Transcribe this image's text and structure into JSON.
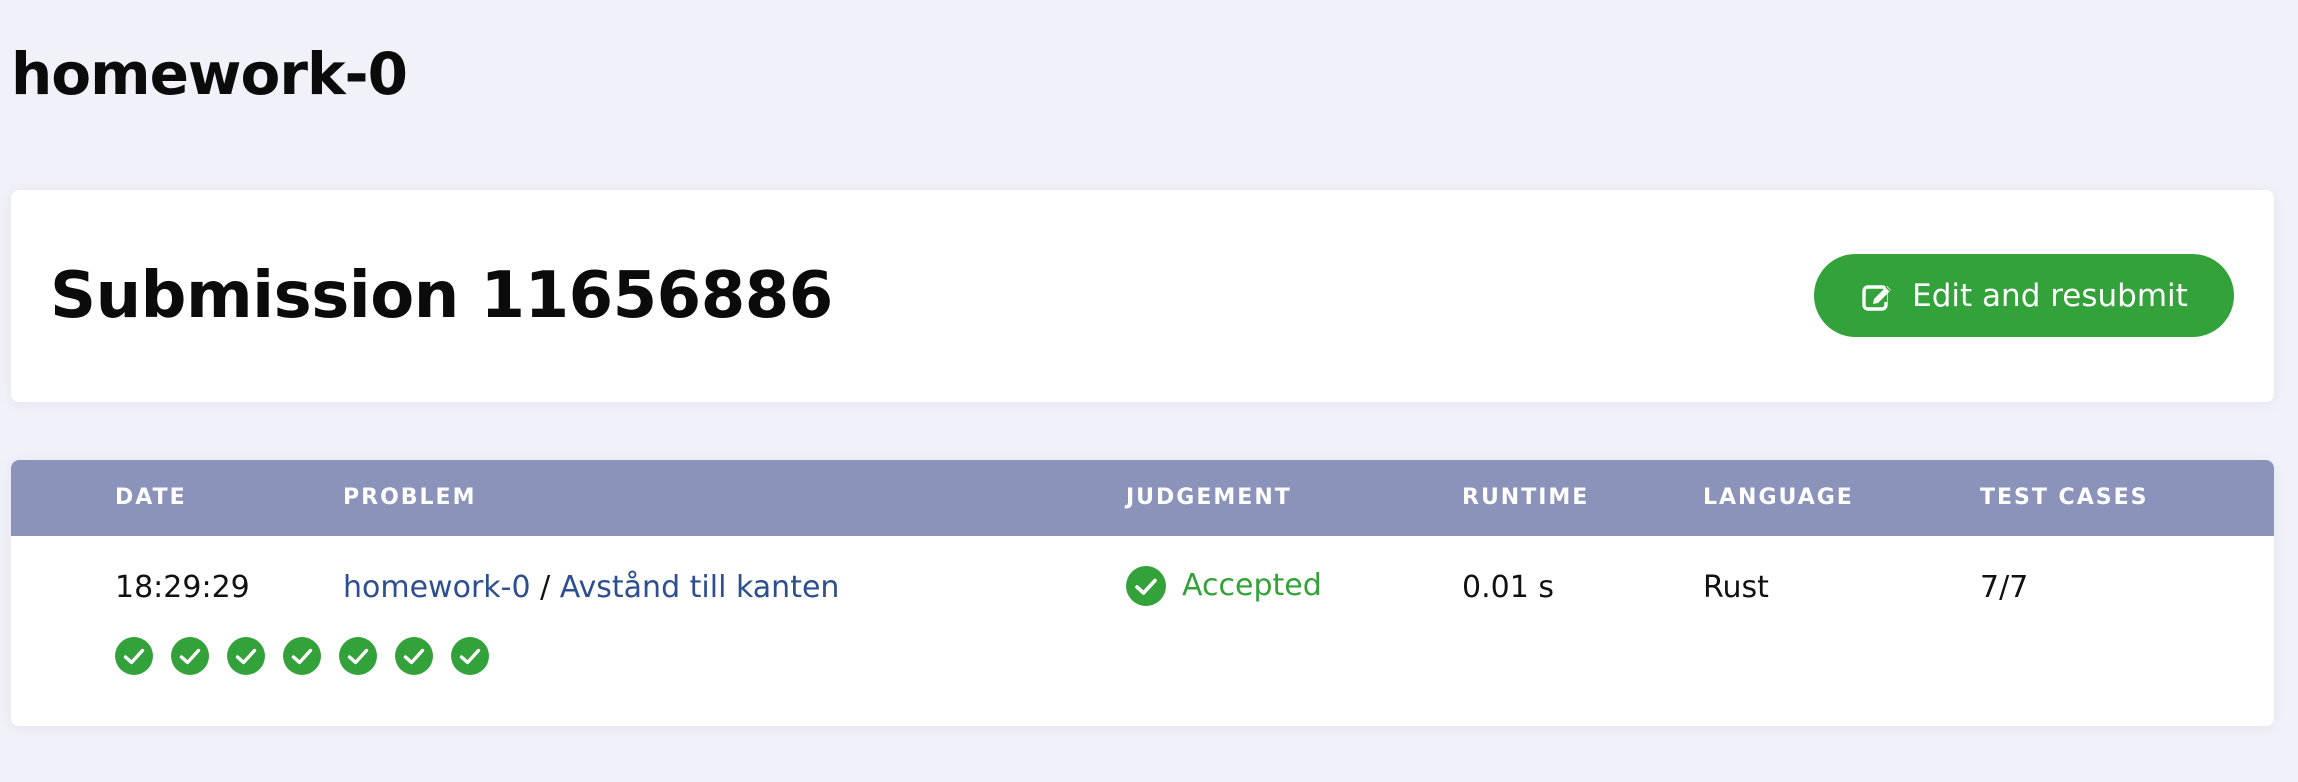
{
  "page": {
    "title": "homework-0"
  },
  "submission": {
    "title": "Submission 11656886",
    "resubmit_label": "Edit and resubmit",
    "resubmit_icon": "edit-icon"
  },
  "table": {
    "headers": {
      "date": "DATE",
      "problem": "PROBLEM",
      "judgement": "JUDGEMENT",
      "runtime": "RUNTIME",
      "language": "LANGUAGE",
      "test_cases": "TEST CASES"
    },
    "row": {
      "date": "18:29:29",
      "contest": "homework-0",
      "separator": "/",
      "problem": "Avstånd till kanten",
      "judgement": "Accepted",
      "judgement_icon": "check-circle-icon",
      "runtime": "0.01 s",
      "language": "Rust",
      "test_cases": "7/7",
      "test_case_results": [
        "accepted",
        "accepted",
        "accepted",
        "accepted",
        "accepted",
        "accepted",
        "accepted"
      ]
    }
  },
  "colors": {
    "accepted": "#34a23a",
    "header_bg": "#8c93ba",
    "link": "#2d4e8f",
    "page_bg": "#f1f1f9"
  }
}
